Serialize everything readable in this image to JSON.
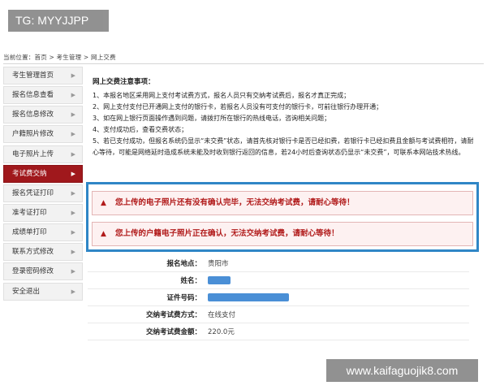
{
  "tag": {
    "text": "TG: MYYJJPP"
  },
  "watermark": {
    "text": "www.kaifaguojik8.com"
  },
  "breadcrumb": {
    "text": "当前位置：首页 > 考生管理 > 网上交费"
  },
  "sidebar": {
    "active_color": "#a0181c",
    "items": [
      {
        "label": "考生管理首页"
      },
      {
        "label": "报名信息查看"
      },
      {
        "label": "报名信息修改"
      },
      {
        "label": "户籍照片修改"
      },
      {
        "label": "电子照片上传"
      },
      {
        "label": "考试费交纳"
      },
      {
        "label": "报名凭证打印"
      },
      {
        "label": "准考证打印"
      },
      {
        "label": "成绩单打印"
      },
      {
        "label": "联系方式修改"
      },
      {
        "label": "登录密码修改"
      },
      {
        "label": "安全退出"
      }
    ]
  },
  "notice": {
    "title": "网上交费注意事项：",
    "lines": [
      "1、本报名地区采用网上支付考试费方式，报名人员只有交纳考试费后，报名才真正完成；",
      "2、网上支付支付已开通网上支付的银行卡，若报名人员没有可支付的银行卡，可前往银行办理开通；",
      "3、如在网上银行页面操作遇到问题，请拨打所在银行的热线电话，咨询相关问题；",
      "4、支付成功后，查看交费状态；",
      "5、若已支付成功，但报名系统仍显示“未交费”状态，请首先核对银行卡是否已经扣费，若银行卡已经扣费且金额与考试费相符，请耐心等待，可能是网络延时造成系统未能及时收到银行返回的信息，若24小时后查询状态仍显示“未交费”，可联系本网站技术热线。"
    ]
  },
  "alerts": {
    "frame_color": "#2f86c6",
    "text_color": "#b11a1a",
    "first": "您上传的电子照片还有没有确认完毕，无法交纳考试费，请耐心等待！",
    "second": "您上传的户籍电子照片正在确认，无法交纳考试费，请耐心等待！"
  },
  "info": {
    "rows": [
      {
        "label": "报名地点：",
        "value": "贵阳市"
      },
      {
        "label": "姓名：",
        "value": ""
      },
      {
        "label": "证件号码：",
        "value": ""
      },
      {
        "label": "交纳考试费方式：",
        "value": "在线支付"
      },
      {
        "label": "交纳考试费金额：",
        "value": "220.0元"
      }
    ]
  }
}
